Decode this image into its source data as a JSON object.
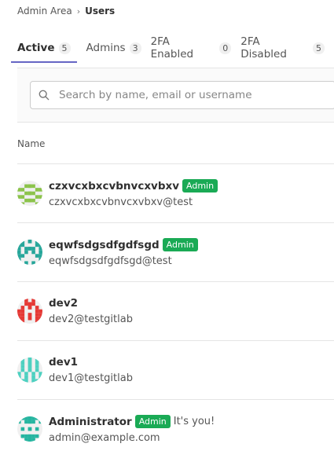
{
  "breadcrumb": {
    "parent": "Admin Area",
    "separator": "›",
    "current": "Users"
  },
  "tabs": [
    {
      "label": "Active",
      "count": "5"
    },
    {
      "label": "Admins",
      "count": "3"
    },
    {
      "label": "2FA Enabled",
      "count": "0"
    },
    {
      "label": "2FA Disabled",
      "count": "5"
    }
  ],
  "search": {
    "placeholder": "Search by name, email or username",
    "value": ""
  },
  "table": {
    "column_name": "Name"
  },
  "admin_badge_label": "Admin",
  "users": [
    {
      "name": "czxvcxbxcvbnvcxvbxv",
      "email": "czxvcxbxcvbnvcxvbxv@test",
      "admin": true,
      "self_note": "",
      "avatar_color": "#8bc34a"
    },
    {
      "name": "eqwfsdgsdfgdfsgd",
      "email": "eqwfsdgsdfgdfsgd@test",
      "admin": true,
      "self_note": "",
      "avatar_color": "#26a69a"
    },
    {
      "name": "dev2",
      "email": "dev2@testgitlab",
      "admin": false,
      "self_note": "",
      "avatar_color": "#e53935"
    },
    {
      "name": "dev1",
      "email": "dev1@testgitlab",
      "admin": false,
      "self_note": "",
      "avatar_color": "#4dd0c0"
    },
    {
      "name": "Administrator",
      "email": "admin@example.com",
      "admin": true,
      "self_note": "It's you!",
      "avatar_color": "#26b5a0"
    }
  ],
  "colors": {
    "accent": "#6666c4",
    "admin_badge": "#1aaa55"
  }
}
